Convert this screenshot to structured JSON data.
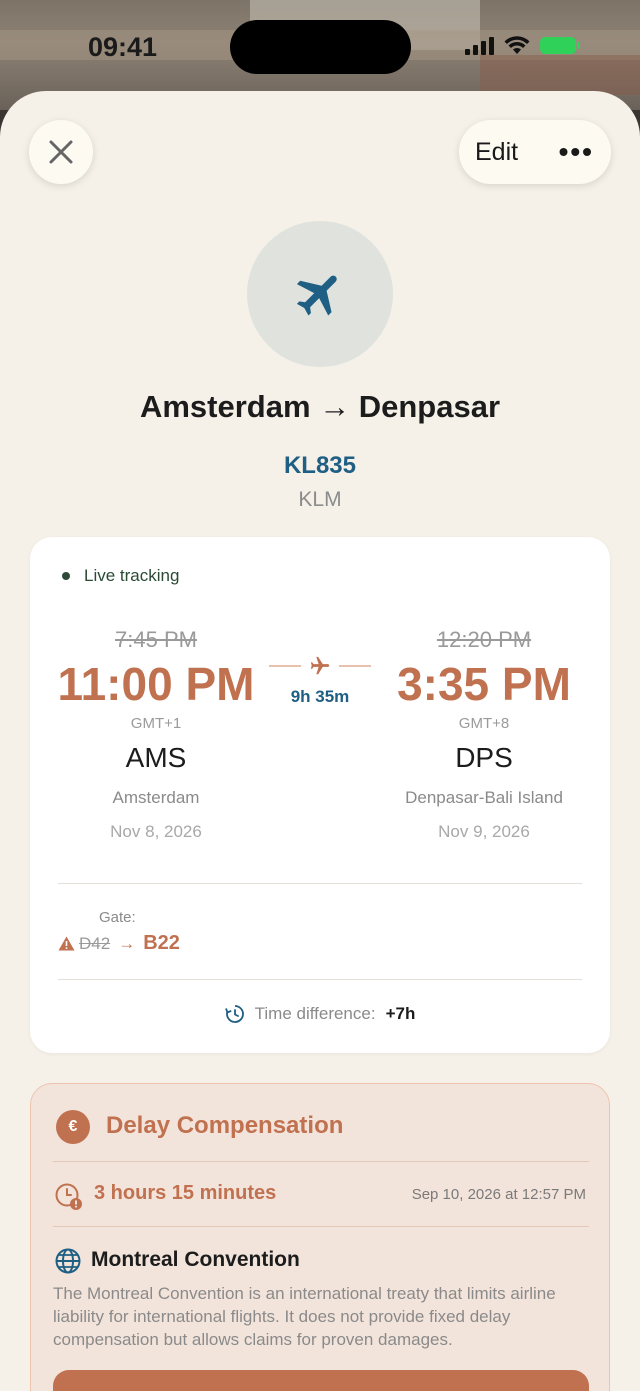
{
  "status_bar": {
    "time": "09:41"
  },
  "header": {
    "edit_label": "Edit",
    "more_icon": "•••"
  },
  "flight": {
    "route": "Amsterdam → Denpasar",
    "number": "KL835",
    "airline": "KLM"
  },
  "tracking": {
    "live_label": "Live tracking",
    "departure": {
      "scheduled": "7:45 PM",
      "actual": "11:00 PM",
      "timezone": "GMT+1",
      "code": "AMS",
      "city": "Amsterdam",
      "date": "Nov 8, 2026"
    },
    "duration": "9h 35m",
    "arrival": {
      "scheduled": "12:20 PM",
      "actual": "3:35 PM",
      "timezone": "GMT+8",
      "code": "DPS",
      "city": "Denpasar-Bali Island",
      "date": "Nov 9, 2026"
    },
    "gate": {
      "label": "Gate:",
      "old": "D42",
      "arrow": "→",
      "new": "B22"
    },
    "time_difference": {
      "label": "Time difference:",
      "value": "+7h"
    }
  },
  "compensation": {
    "title": "Delay Compensation",
    "euro_symbol": "€",
    "delay": "3 hours 15 minutes",
    "delay_date": "Sep 10, 2026 at 12:57 PM",
    "convention_title": "Montreal Convention",
    "convention_body": "The Montreal Convention is an international treaty that limits airline liability for international flights. It does not provide fixed delay compensation but allows claims for proven damages."
  },
  "colors": {
    "accent": "#c0714f",
    "link_blue": "#1f5f84",
    "sheet_bg": "#f5f1e9"
  },
  "icons": {
    "close": "close-icon",
    "plane": "airplane-icon",
    "warning": "warning-icon",
    "cycle": "time-cycle-icon",
    "clock_alert": "clock-alert-icon",
    "globe": "globe-icon"
  }
}
